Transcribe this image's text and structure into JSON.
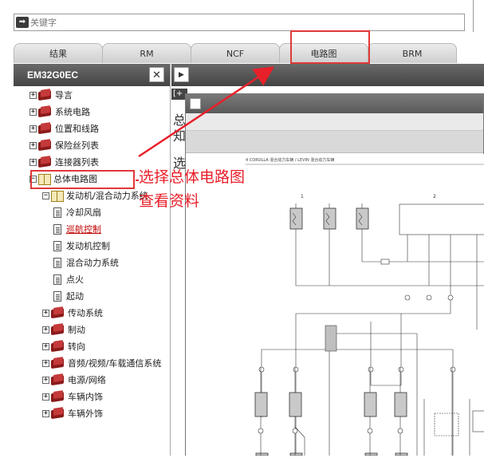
{
  "search": {
    "placeholder": "关键字",
    "icon": "arrow-right-icon"
  },
  "tabs": [
    {
      "label": "结果"
    },
    {
      "label": "RM"
    },
    {
      "label": "NCF"
    },
    {
      "label": "电路图"
    },
    {
      "label": "BRM"
    }
  ],
  "left_panel": {
    "title": "EM32G0EC",
    "close_label": "✕",
    "tree": [
      {
        "label": "导言",
        "level": 0,
        "icon": "book-icon",
        "expander": "+"
      },
      {
        "label": "系统电路",
        "level": 0,
        "icon": "book-icon",
        "expander": "+"
      },
      {
        "label": "位置和线路",
        "level": 0,
        "icon": "book-icon",
        "expander": "+"
      },
      {
        "label": "保险丝列表",
        "level": 0,
        "icon": "book-icon",
        "expander": "+"
      },
      {
        "label": "连接器列表",
        "level": 0,
        "icon": "book-icon",
        "expander": "+"
      },
      {
        "label": "总体电路图",
        "level": 0,
        "icon": "open-book-icon",
        "expander": "−"
      },
      {
        "label": "发动机/混合动力系统",
        "level": 1,
        "icon": "open-book-icon",
        "expander": "−"
      },
      {
        "label": "冷却风扇",
        "level": 2,
        "icon": "page-icon"
      },
      {
        "label": "巡航控制",
        "level": 2,
        "icon": "page-icon",
        "selected": true
      },
      {
        "label": "发动机控制",
        "level": 2,
        "icon": "page-icon"
      },
      {
        "label": "混合动力系统",
        "level": 2,
        "icon": "page-icon"
      },
      {
        "label": "点火",
        "level": 2,
        "icon": "page-icon"
      },
      {
        "label": "起动",
        "level": 2,
        "icon": "page-icon"
      },
      {
        "label": "传动系统",
        "level": 1,
        "icon": "book-icon",
        "expander": "+"
      },
      {
        "label": "制动",
        "level": 1,
        "icon": "book-icon",
        "expander": "+"
      },
      {
        "label": "转向",
        "level": 1,
        "icon": "book-icon",
        "expander": "+"
      },
      {
        "label": "音频/视频/车载通信系统",
        "level": 1,
        "icon": "book-icon",
        "expander": "+"
      },
      {
        "label": "电源/网络",
        "level": 1,
        "icon": "book-icon",
        "expander": "+"
      },
      {
        "label": "车辆内饰",
        "level": 1,
        "icon": "book-icon",
        "expander": "+"
      },
      {
        "label": "车辆外饰",
        "level": 1,
        "icon": "book-icon",
        "expander": "+"
      }
    ]
  },
  "right_area": {
    "next_label": "▶",
    "bg_bracket": "[+",
    "bg_chars": [
      "总",
      "知",
      "选"
    ]
  },
  "popup": {
    "header_text": "4   COROLLA 混合动力车辆 / LEVIN 混合动力车辆",
    "col_label_1": "1",
    "col_label_2": "2"
  },
  "annotation": {
    "line1": "选择总体电路图",
    "line2": "查看资料",
    "color": "#e8202a"
  }
}
